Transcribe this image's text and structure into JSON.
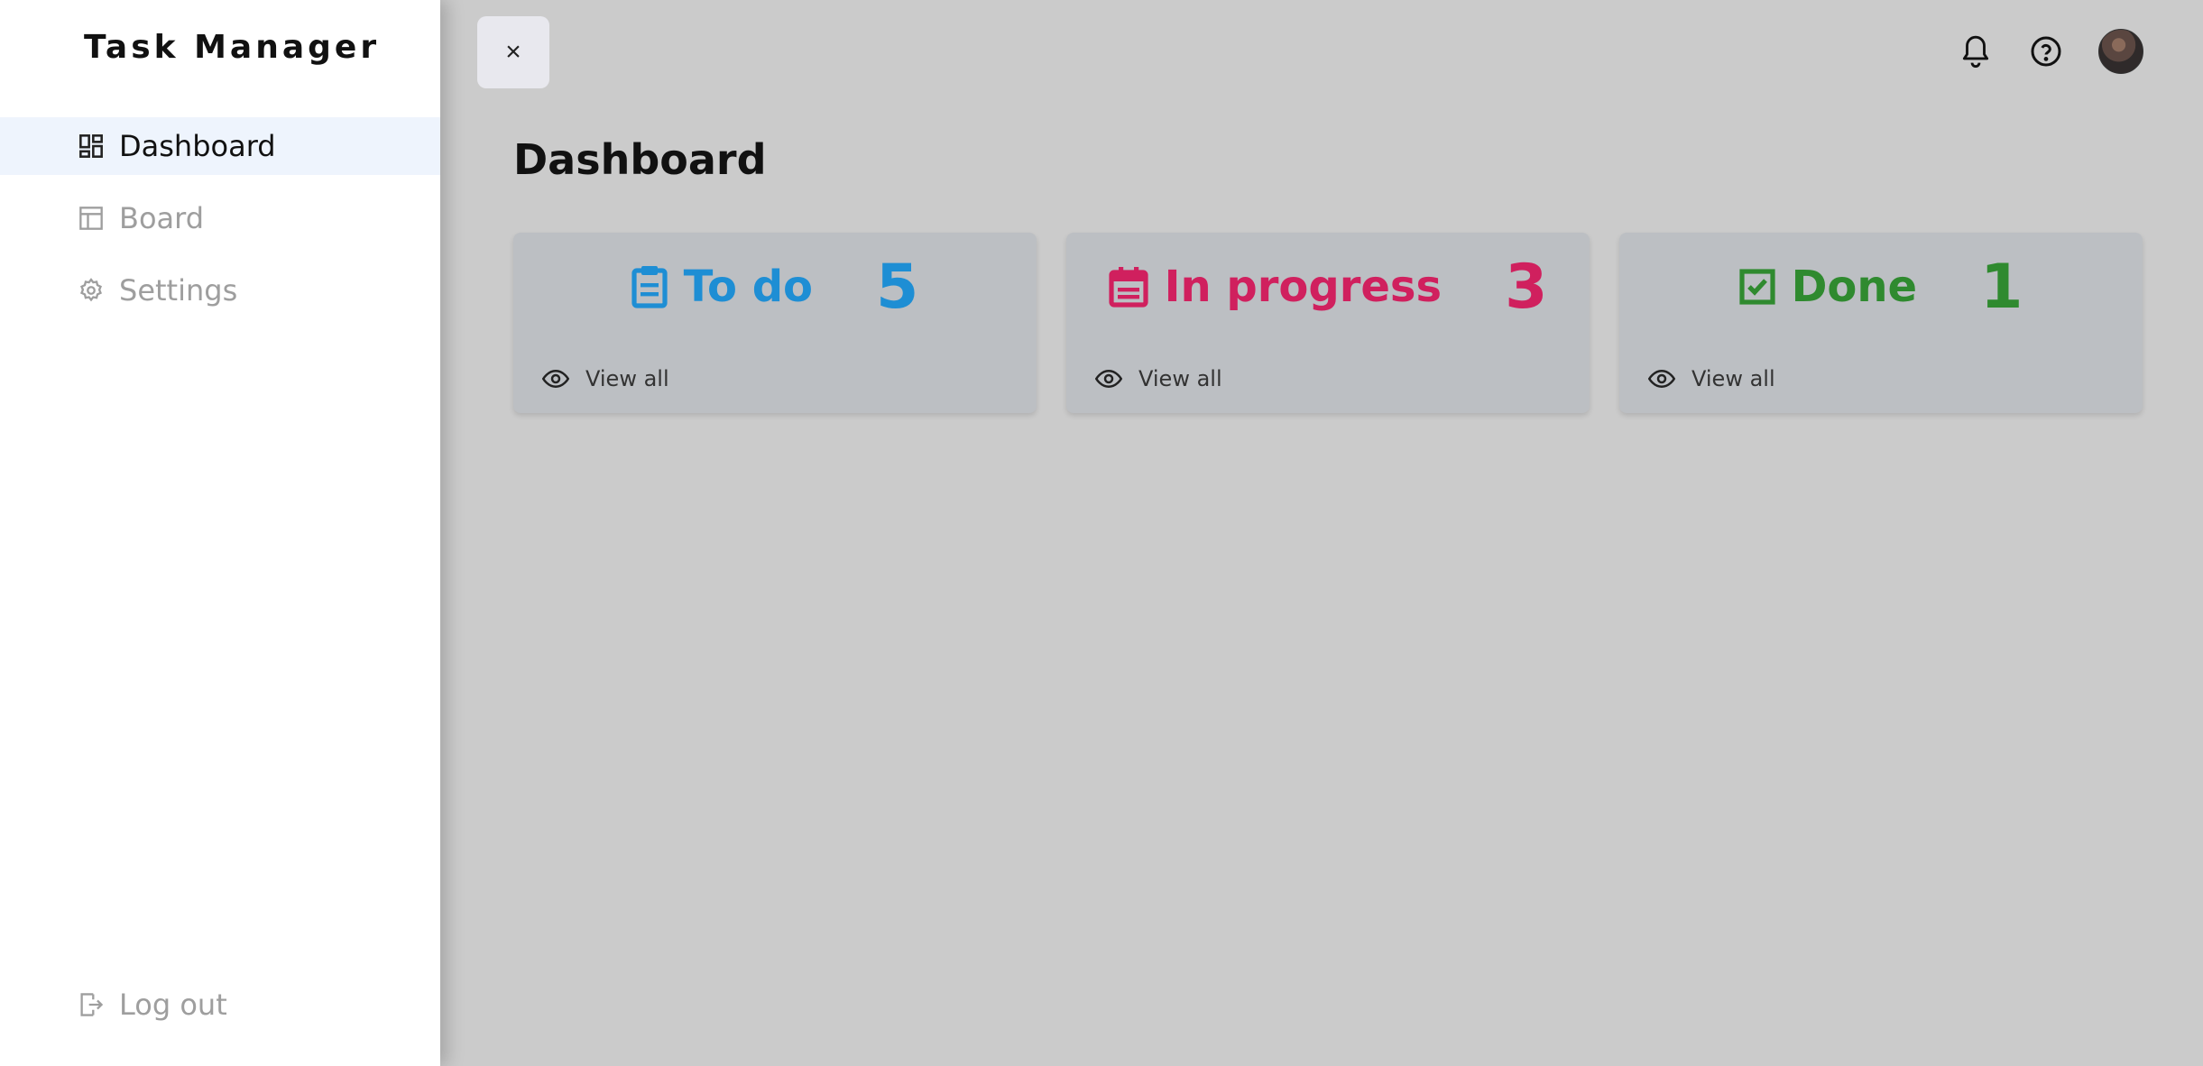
{
  "app": {
    "title": "Task Manager"
  },
  "sidebar": {
    "items": [
      {
        "label": "Dashboard",
        "icon": "dashboard-icon",
        "active": true
      },
      {
        "label": "Board",
        "icon": "board-icon",
        "active": false
      },
      {
        "label": "Settings",
        "icon": "gear-icon",
        "active": false
      }
    ],
    "logout_label": "Log out"
  },
  "header": {
    "close_glyph": "×"
  },
  "main": {
    "title": "Dashboard",
    "cards": [
      {
        "title": "To do",
        "count": "5",
        "view_label": "View all",
        "color": "#1e8ed4",
        "icon": "clipboard-icon"
      },
      {
        "title": "In progress",
        "count": "3",
        "view_label": "View all",
        "color": "#d0205e",
        "icon": "calendar-icon"
      },
      {
        "title": "Done",
        "count": "1",
        "view_label": "View all",
        "color": "#2f8a2f",
        "icon": "checkbox-icon"
      }
    ]
  }
}
